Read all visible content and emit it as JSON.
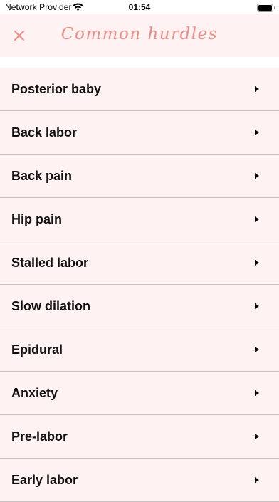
{
  "status_bar": {
    "carrier": "Network Provider",
    "time": "01:54",
    "wifi_icon": "wifi-icon",
    "battery_icon": "battery-icon"
  },
  "header": {
    "title": "Common hurdles",
    "close_icon": "close-icon",
    "accent_color": "#ee8d86",
    "background_color": "#fff2f2"
  },
  "list": {
    "chevron_icon": "triangle-right-icon",
    "items": [
      {
        "label": "Posterior baby"
      },
      {
        "label": "Back labor"
      },
      {
        "label": "Back pain"
      },
      {
        "label": "Hip pain"
      },
      {
        "label": "Stalled labor"
      },
      {
        "label": "Slow dilation"
      },
      {
        "label": "Epidural"
      },
      {
        "label": "Anxiety"
      },
      {
        "label": "Pre-labor"
      },
      {
        "label": "Early labor"
      }
    ]
  }
}
